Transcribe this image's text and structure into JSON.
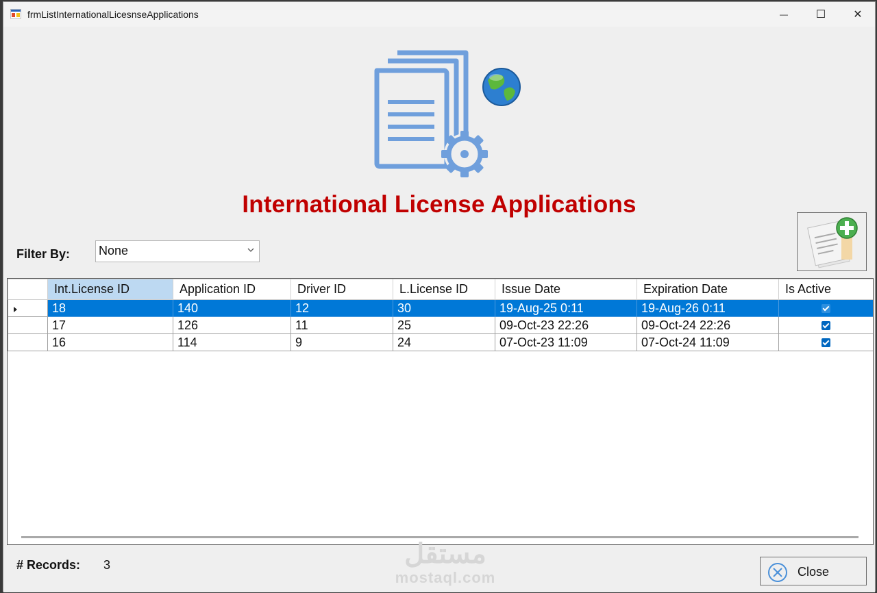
{
  "window": {
    "title": "frmListInternationalLicesnseApplications",
    "minimize_glyph": "—",
    "maximize_glyph": "☐",
    "close_glyph": "✕"
  },
  "header": {
    "title": "International License Applications",
    "logo_icon": "documents-gear-globe-icon",
    "title_color": "#c00000"
  },
  "add_button": {
    "icon": "add-document-icon"
  },
  "filter": {
    "label": "Filter By:",
    "selected": "None"
  },
  "grid": {
    "columns": [
      "Int.License ID",
      "Application ID",
      "Driver ID",
      "L.License ID",
      "Issue Date",
      "Expiration Date",
      "Is Active"
    ],
    "selected_row": 0,
    "rows": [
      {
        "int_license_id": "18",
        "application_id": "140",
        "driver_id": "12",
        "l_license_id": "30",
        "issue_date": "19-Aug-25 0:11",
        "expiration_date": "19-Aug-26 0:11",
        "is_active": true
      },
      {
        "int_license_id": "17",
        "application_id": "126",
        "driver_id": "11",
        "l_license_id": "25",
        "issue_date": "09-Oct-23 22:26",
        "expiration_date": "09-Oct-24 22:26",
        "is_active": true
      },
      {
        "int_license_id": "16",
        "application_id": "114",
        "driver_id": "9",
        "l_license_id": "24",
        "issue_date": "07-Oct-23 11:09",
        "expiration_date": "07-Oct-24 11:09",
        "is_active": true
      }
    ],
    "selection_color": "#0078d7"
  },
  "footer": {
    "records_label": "# Records:",
    "records_value": "3",
    "close_label": "Close"
  },
  "watermark": {
    "arabic": "مستقل",
    "latin": "mostaql.com"
  }
}
